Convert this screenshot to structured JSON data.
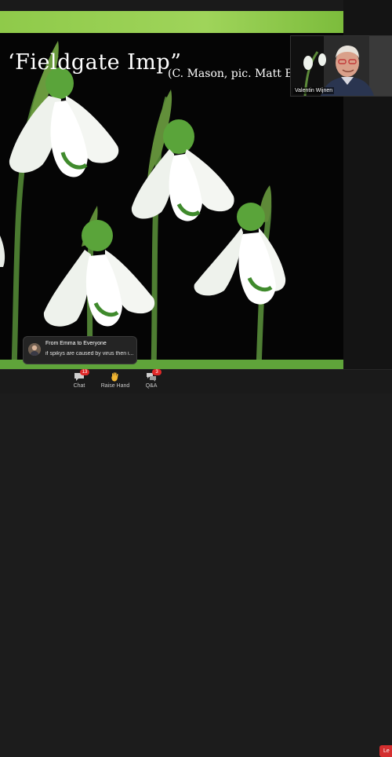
{
  "slide": {
    "title": "‘Fieldgate Imp”",
    "credit": "(C. Mason, pic. Matt Bis"
  },
  "video": {
    "participant_name": "Valentin Wijnen"
  },
  "chat_toast": {
    "title": "From Emma to Everyone",
    "message": "if spikys are caused by virus then i..."
  },
  "toolbar": {
    "chat_label": "Chat",
    "chat_badge": "13",
    "raise_hand_label": "Raise Hand",
    "qa_label": "Q&A",
    "qa_badge": "3",
    "leave_label": "Le"
  },
  "colors": {
    "slide_accent": "#8fca4a",
    "leave": "#d32f2f",
    "badge": "#e02828"
  }
}
